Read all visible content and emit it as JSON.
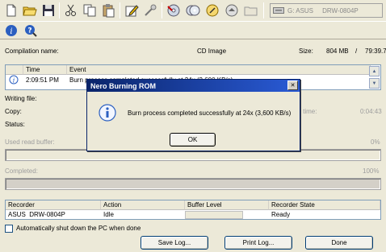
{
  "toolbar": {
    "drive_label": "G: ASUS     DRW-0804P",
    "icons": [
      "new-icon",
      "open-icon",
      "save-icon",
      "cut-icon",
      "copy-icon",
      "paste-icon",
      "edit-icon",
      "burn-wizard-icon",
      "burn-disc-icon",
      "copy-disc-icon",
      "info-disc-icon",
      "eject-icon",
      "folder-icon",
      "drive-icon"
    ]
  },
  "toolbar2": {
    "icons": [
      "info-icon",
      "help-icon"
    ]
  },
  "compilation": {
    "name_label": "Compilation name:",
    "type_value": "CD Image",
    "size_label": "Size:",
    "size_value": "804 MB",
    "size_sep": "/",
    "size_time": "79:39.7"
  },
  "log": {
    "col_time": "Time",
    "col_event": "Event",
    "row_time": "2:09:51 PM",
    "row_event": "Burn process completed successfully at 24x (3,600 KB/s)"
  },
  "status": {
    "writing_file_label": "Writing file:",
    "copy_label": "Copy:",
    "status_label": "Status:",
    "total_time_label": "Total time:",
    "total_time_value": "0:04:43",
    "read_buffer_label": "Used read buffer:",
    "read_buffer_pct": "0%",
    "read_buffer_fraction": 0,
    "completed_label": "Completed:",
    "completed_pct": "100%",
    "completed_fraction": 1.0
  },
  "recorder_table": {
    "headers": [
      "Recorder",
      "Action",
      "Buffer Level",
      "Recorder State"
    ],
    "rows": [
      {
        "recorder": "ASUS  DRW-0804P",
        "action": "Idle",
        "buffer": "",
        "state": "Ready"
      }
    ]
  },
  "shutdown_label": "Automatically shut down the PC when done",
  "buttons": {
    "save_log": "Save Log...",
    "print_log": "Print Log...",
    "done": "Done"
  },
  "dialog": {
    "title": "Nero Burning ROM",
    "message": "Burn process completed successfully at 24x (3,600 KB/s)",
    "ok": "OK",
    "close": "✕",
    "icon": "information-icon"
  },
  "colors": {
    "titlebar": "#0a246a",
    "titlebar_end": "#2a5bd6",
    "progress_fill": "#d4d0c8"
  }
}
